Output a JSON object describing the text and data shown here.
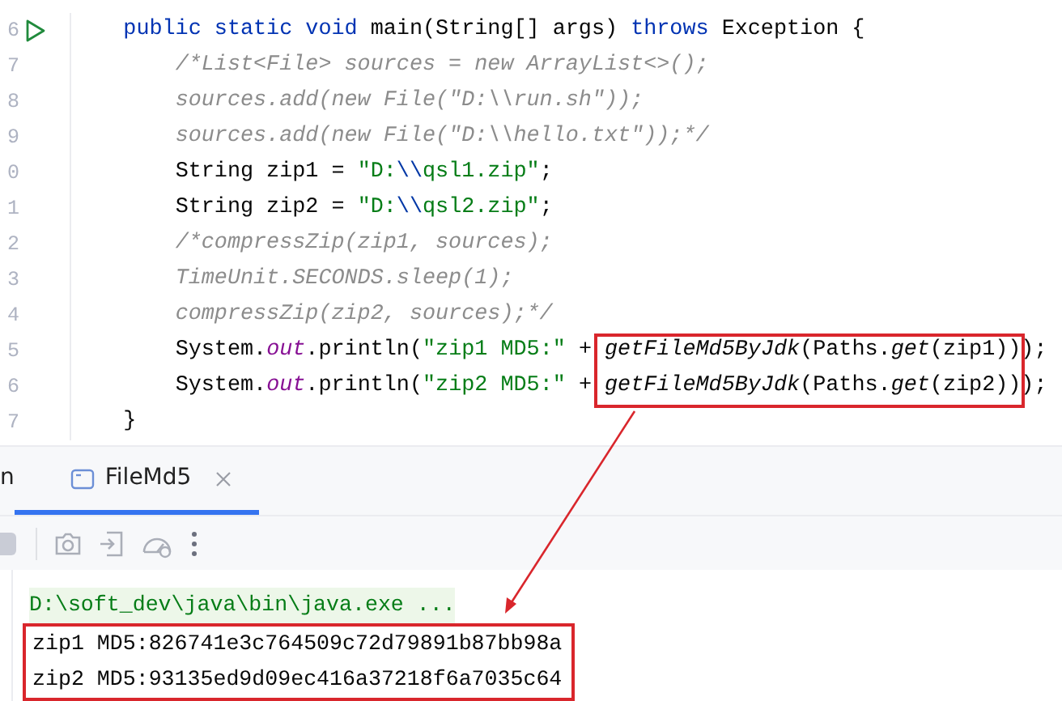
{
  "editor": {
    "lines": [
      {
        "number": "6",
        "runnable": true,
        "tokens": [
          {
            "text": "public static void",
            "kind": "keyword"
          },
          {
            "text": " main(String[] args) ",
            "kind": "plain"
          },
          {
            "text": "throws",
            "kind": "keyword"
          },
          {
            "text": " Exception {",
            "kind": "plain"
          }
        ],
        "children": [
          {
            "number": "7",
            "runnable": false,
            "tokens": [
              {
                "text": "/*List<File> sources = new ArrayList<>();",
                "kind": "comment"
              }
            ]
          },
          {
            "number": "8",
            "runnable": false,
            "tokens": [
              {
                "text": "sources.add(new File(\"D:\\\\run.sh\"));",
                "kind": "comment"
              }
            ]
          },
          {
            "number": "9",
            "runnable": false,
            "tokens": [
              {
                "text": "sources.add(new File(\"D:\\\\hello.txt\"));*/",
                "kind": "comment"
              }
            ]
          },
          {
            "number": "0",
            "runnable": false,
            "tokens": [
              {
                "text": "String zip1 = ",
                "kind": "plain"
              },
              {
                "text": "\"D:",
                "kind": "string"
              },
              {
                "text": "\\\\",
                "kind": "escape"
              },
              {
                "text": "qsl1.zip\"",
                "kind": "string"
              },
              {
                "text": ";",
                "kind": "plain"
              }
            ]
          },
          {
            "number": "1",
            "runnable": false,
            "tokens": [
              {
                "text": "String zip2 = ",
                "kind": "plain"
              },
              {
                "text": "\"D:",
                "kind": "string"
              },
              {
                "text": "\\\\",
                "kind": "escape"
              },
              {
                "text": "qsl2.zip\"",
                "kind": "string"
              },
              {
                "text": ";",
                "kind": "plain"
              }
            ]
          },
          {
            "number": "2",
            "runnable": false,
            "tokens": [
              {
                "text": "/*compressZip(zip1, sources);",
                "kind": "comment"
              }
            ]
          },
          {
            "number": "3",
            "runnable": false,
            "tokens": [
              {
                "text": "TimeUnit.SECONDS.sleep(1);",
                "kind": "comment"
              }
            ]
          },
          {
            "number": "4",
            "runnable": false,
            "tokens": [
              {
                "text": "compressZip(zip2, sources);*/",
                "kind": "comment"
              }
            ]
          },
          {
            "number": "5",
            "runnable": false,
            "tokens": [
              {
                "text": "System.",
                "kind": "plain"
              },
              {
                "text": "out",
                "kind": "field"
              },
              {
                "text": ".println(",
                "kind": "plain"
              },
              {
                "text": "\"zip1 MD5:\"",
                "kind": "string"
              },
              {
                "text": " + ",
                "kind": "plain"
              },
              {
                "text": "getFileMd5ByJdk",
                "kind": "call"
              },
              {
                "text": "(Paths.",
                "kind": "plain"
              },
              {
                "text": "get",
                "kind": "call"
              },
              {
                "text": "(zip1)));",
                "kind": "plain"
              }
            ]
          },
          {
            "number": "6",
            "runnable": false,
            "tokens": [
              {
                "text": "System.",
                "kind": "plain"
              },
              {
                "text": "out",
                "kind": "field"
              },
              {
                "text": ".println(",
                "kind": "plain"
              },
              {
                "text": "\"zip2 MD5:\"",
                "kind": "string"
              },
              {
                "text": " + ",
                "kind": "plain"
              },
              {
                "text": "getFileMd5ByJdk",
                "kind": "call"
              },
              {
                "text": "(Paths.",
                "kind": "plain"
              },
              {
                "text": "get",
                "kind": "call"
              },
              {
                "text": "(zip2)));",
                "kind": "plain"
              }
            ]
          }
        ]
      },
      {
        "number": "7",
        "runnable": false,
        "tokens": [
          {
            "text": "}",
            "kind": "plain"
          }
        ]
      }
    ]
  },
  "tool_window": {
    "tabs": [
      {
        "label": "n",
        "selected": false,
        "closable": false
      },
      {
        "label": "FileMd5",
        "selected": true,
        "closable": true
      }
    ],
    "console": [
      {
        "text": "D:\\soft_dev\\java\\bin\\java.exe ...",
        "kind": "command"
      },
      {
        "text": "zip1 MD5:826741e3c764509c72d79891b87bb98a",
        "kind": "output"
      },
      {
        "text": "zip2 MD5:93135ed9d09ec416a37218f6a7035c64",
        "kind": "output"
      }
    ]
  }
}
